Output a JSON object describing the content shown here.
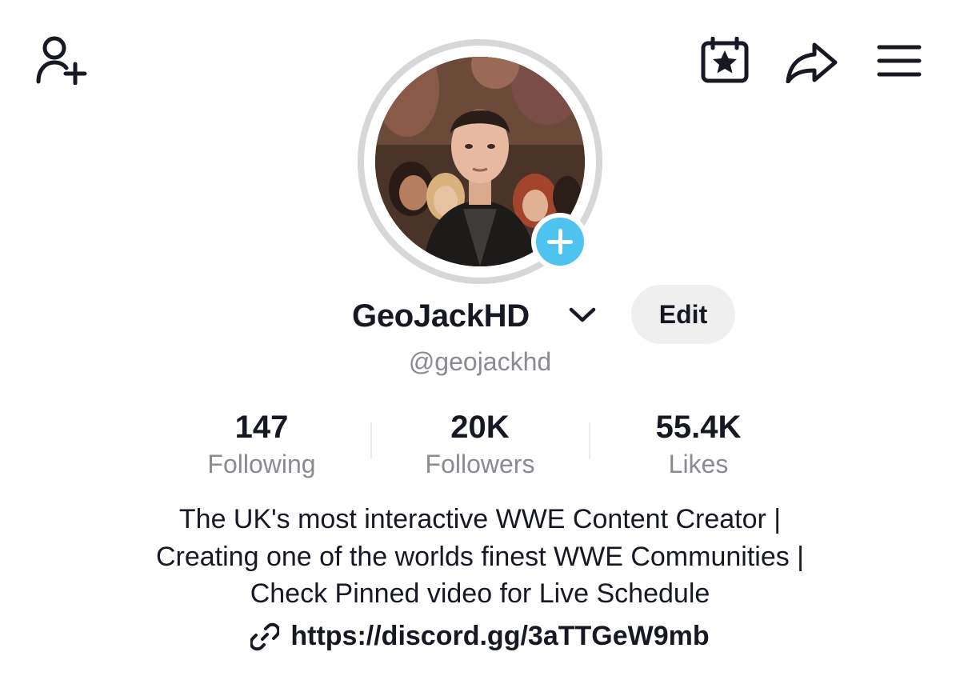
{
  "header": {
    "icons": {
      "add_friend": "person-plus-icon",
      "calendar": "calendar-star-icon",
      "share": "share-arrow-icon",
      "menu": "hamburger-menu-icon"
    }
  },
  "profile": {
    "display_name": "GeoJackHD",
    "handle": "@geojackhd",
    "edit_label": "Edit",
    "accent_color": "#4ec3ef"
  },
  "stats": [
    {
      "value": "147",
      "label": "Following"
    },
    {
      "value": "20K",
      "label": "Followers"
    },
    {
      "value": "55.4K",
      "label": "Likes"
    }
  ],
  "bio": {
    "lines": [
      "The UK's most interactive WWE Content Creator |",
      "Creating one of the worlds finest WWE Communities |",
      "Check Pinned video for Live Schedule"
    ],
    "link": "https://discord.gg/3aTTGeW9mb"
  }
}
